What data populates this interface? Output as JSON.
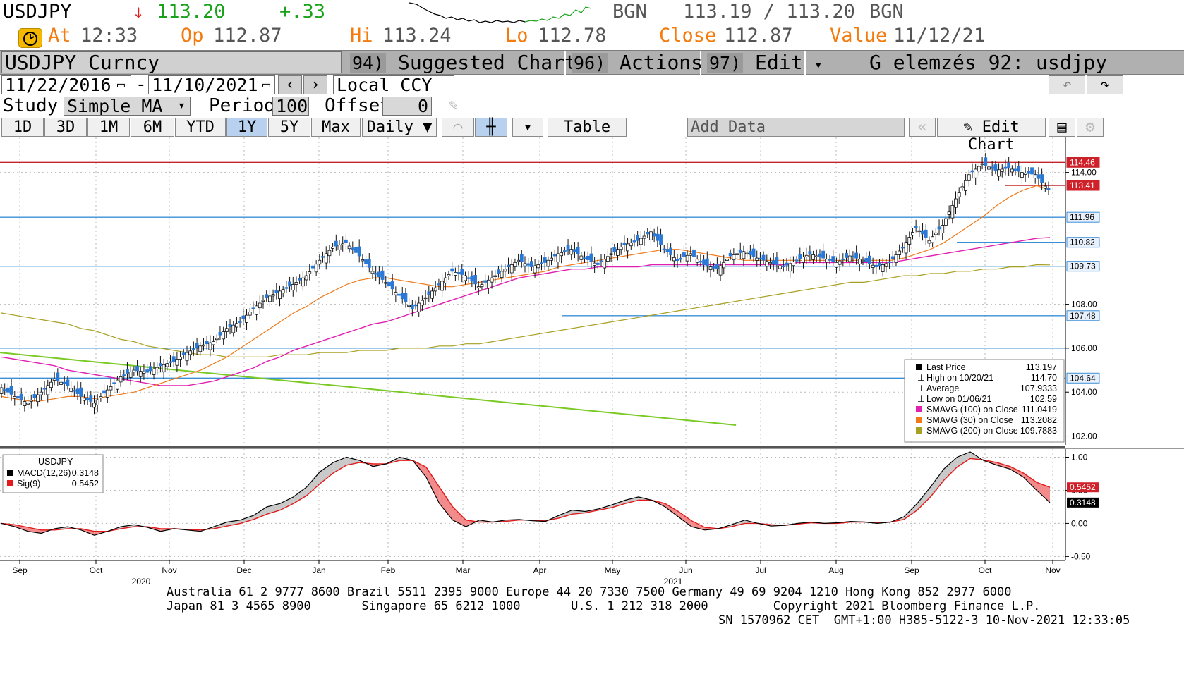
{
  "quote": {
    "ticker": "USDJPY",
    "arrow": "↓",
    "last": "113.20",
    "change": "+.33",
    "bid_src": "BGN",
    "bid_ask": "113.19 / 113.20",
    "ask_src": "BGN",
    "at_label": "At",
    "at_time": "12:33",
    "op_label": "Op",
    "op_value": "112.87",
    "hi_label": "Hi",
    "hi_value": "113.24",
    "lo_label": "Lo",
    "lo_value": "112.78",
    "close_label": "Close",
    "close_value": "112.87",
    "value_label": "Value",
    "value_date": "11/12/21"
  },
  "toolbar": {
    "security": "USDJPY Curncy",
    "suggested_num": "94)",
    "suggested": "Suggested Charts",
    "actions_num": "96)",
    "actions": "Actions",
    "edit_num": "97)",
    "edit": "Edit",
    "title": "G elemzés 92: usdjpy",
    "date_from": "11/22/2016",
    "date_sep": "-",
    "date_to": "11/10/2021",
    "currency": "Local CCY",
    "study_label": "Study",
    "study_value": "Simple MA",
    "period_label": "Period",
    "period_value": "100",
    "offset_label": "Offset",
    "offset_value": "0",
    "tabs": [
      "1D",
      "3D",
      "1M",
      "6M",
      "YTD",
      "1Y",
      "5Y",
      "Max"
    ],
    "selected_tab": "1Y",
    "frequency": "Daily ▼",
    "table": "Table",
    "add_data": "Add Data",
    "edit_chart": "Edit Chart"
  },
  "chart_data": {
    "type": "line",
    "price_panel": {
      "yticks": [
        "114.00",
        "108.00",
        "106.00",
        "104.00",
        "102.00"
      ],
      "ylim": [
        101.6,
        115.4
      ],
      "level_labels": [
        {
          "text": "114.46",
          "value": 114.46,
          "style": "red"
        },
        {
          "text": "113.41",
          "value": 113.41,
          "style": "red"
        },
        {
          "text": "111.96",
          "value": 111.96,
          "style": "blue"
        },
        {
          "text": "110.82",
          "value": 110.82,
          "style": "blue"
        },
        {
          "text": "109.73",
          "value": 109.73,
          "style": "blue"
        },
        {
          "text": "107.48",
          "value": 107.48,
          "style": "blue"
        },
        {
          "text": "104.64",
          "value": 104.64,
          "style": "blue"
        }
      ],
      "legend": [
        {
          "label": "Last Price",
          "value": "113.197",
          "color": "#000000"
        },
        {
          "label": "High on 10/20/21",
          "value": "114.70",
          "color": ""
        },
        {
          "label": "Average",
          "value": "107.9333",
          "color": ""
        },
        {
          "label": "Low on 01/06/21",
          "value": "102.59",
          "color": ""
        },
        {
          "label": "SMAVG (100)  on Close",
          "value": "111.0419",
          "color": "#e020b0"
        },
        {
          "label": "SMAVG (30)  on Close",
          "value": "113.2082",
          "color": "#f07a1a"
        },
        {
          "label": "SMAVG (200)  on Close",
          "value": "109.7883",
          "color": "#a8a020"
        }
      ],
      "price_series": [
        104.2,
        103.8,
        103.5,
        104.0,
        104.6,
        104.3,
        103.8,
        103.5,
        104.1,
        104.7,
        105.0,
        104.9,
        105.2,
        105.4,
        105.8,
        106.1,
        106.3,
        106.9,
        107.2,
        107.8,
        108.3,
        108.6,
        108.9,
        109.3,
        110.0,
        110.6,
        110.8,
        110.2,
        109.5,
        109.0,
        108.4,
        107.8,
        108.3,
        108.9,
        109.5,
        109.3,
        108.8,
        109.2,
        109.6,
        110.0,
        109.7,
        109.9,
        110.3,
        110.5,
        110.1,
        109.8,
        110.3,
        110.7,
        110.9,
        111.3,
        110.5,
        110.0,
        110.3,
        109.8,
        109.6,
        110.2,
        110.4,
        110.1,
        109.9,
        109.7,
        110.0,
        110.3,
        110.1,
        109.9,
        110.2,
        110.0,
        109.7,
        109.9,
        110.6,
        111.5,
        110.9,
        111.6,
        112.8,
        113.9,
        114.4,
        114.1,
        114.2,
        114.0,
        113.9,
        113.2
      ],
      "sma30_series": [
        103.8,
        103.7,
        103.6,
        103.6,
        103.7,
        103.8,
        103.8,
        103.7,
        103.8,
        103.9,
        104.0,
        104.2,
        104.4,
        104.6,
        104.8,
        105.0,
        105.3,
        105.6,
        106.0,
        106.4,
        106.8,
        107.2,
        107.6,
        107.9,
        108.3,
        108.6,
        108.9,
        109.1,
        109.2,
        109.2,
        109.1,
        109.0,
        108.9,
        108.8,
        108.8,
        108.9,
        109.0,
        109.1,
        109.2,
        109.3,
        109.4,
        109.5,
        109.7,
        109.8,
        109.9,
        110.0,
        110.1,
        110.2,
        110.3,
        110.4,
        110.5,
        110.5,
        110.4,
        110.3,
        110.2,
        110.1,
        110.0,
        110.0,
        110.0,
        110.0,
        110.0,
        110.0,
        110.0,
        110.0,
        110.0,
        110.0,
        110.0,
        110.0,
        110.1,
        110.3,
        110.5,
        110.8,
        111.2,
        111.6,
        112.0,
        112.5,
        112.9,
        113.2,
        113.4,
        113.2
      ],
      "sma100_series": [
        105.6,
        105.5,
        105.4,
        105.3,
        105.2,
        105.0,
        104.9,
        104.8,
        104.7,
        104.6,
        104.5,
        104.4,
        104.3,
        104.3,
        104.3,
        104.4,
        104.5,
        104.7,
        104.9,
        105.1,
        105.4,
        105.6,
        105.9,
        106.1,
        106.3,
        106.5,
        106.7,
        106.9,
        107.1,
        107.2,
        107.4,
        107.6,
        107.8,
        108.0,
        108.2,
        108.4,
        108.6,
        108.8,
        109.0,
        109.2,
        109.3,
        109.4,
        109.5,
        109.6,
        109.6,
        109.7,
        109.7,
        109.7,
        109.7,
        109.8,
        109.8,
        109.8,
        109.8,
        109.8,
        109.8,
        109.8,
        109.8,
        109.8,
        109.8,
        109.8,
        109.9,
        109.9,
        109.9,
        109.9,
        109.9,
        109.9,
        109.9,
        109.9,
        110.0,
        110.1,
        110.2,
        110.3,
        110.4,
        110.5,
        110.6,
        110.7,
        110.8,
        110.9,
        111.0,
        111.04
      ],
      "sma200_series": [
        107.6,
        107.5,
        107.4,
        107.3,
        107.2,
        107.1,
        106.9,
        106.8,
        106.6,
        106.4,
        106.3,
        106.1,
        106.0,
        105.9,
        105.8,
        105.7,
        105.7,
        105.6,
        105.6,
        105.6,
        105.6,
        105.7,
        105.7,
        105.7,
        105.8,
        105.8,
        105.8,
        105.9,
        105.9,
        105.9,
        106.0,
        106.0,
        106.0,
        106.1,
        106.1,
        106.2,
        106.2,
        106.3,
        106.4,
        106.5,
        106.6,
        106.7,
        106.8,
        106.9,
        107.0,
        107.1,
        107.2,
        107.3,
        107.4,
        107.5,
        107.6,
        107.7,
        107.8,
        107.9,
        108.0,
        108.1,
        108.2,
        108.3,
        108.4,
        108.5,
        108.6,
        108.7,
        108.8,
        108.9,
        109.0,
        109.0,
        109.1,
        109.2,
        109.3,
        109.3,
        109.4,
        109.4,
        109.5,
        109.5,
        109.6,
        109.6,
        109.7,
        109.7,
        109.8,
        109.79
      ],
      "trendline": [
        [
          0,
          105.8
        ],
        [
          0.69,
          102.5
        ]
      ]
    },
    "macd_panel": {
      "title": "USDJPY",
      "yticks": [
        "1.00",
        "0.50",
        "0.00",
        "-0.50"
      ],
      "ylim": [
        -0.56,
        1.08
      ],
      "legend": [
        {
          "label": "MACD(12,26)",
          "value": "0.3148",
          "color": "#000000"
        },
        {
          "label": "Sig(9)",
          "value": "0.5452",
          "color": "#e31b1b"
        }
      ],
      "last_labels": [
        {
          "text": "0.5452",
          "value": 0.5452,
          "style": "red"
        },
        {
          "text": "0.3148",
          "value": 0.3148,
          "style": "black"
        }
      ],
      "macd_series": [
        0.0,
        -0.05,
        -0.12,
        -0.15,
        -0.08,
        -0.05,
        -0.1,
        -0.18,
        -0.12,
        -0.05,
        -0.02,
        -0.06,
        -0.12,
        -0.08,
        -0.1,
        -0.12,
        -0.05,
        0.02,
        0.05,
        0.12,
        0.25,
        0.3,
        0.4,
        0.55,
        0.78,
        0.92,
        1.0,
        0.95,
        0.86,
        0.9,
        1.0,
        0.95,
        0.7,
        0.3,
        0.05,
        -0.05,
        0.05,
        0.02,
        0.05,
        0.06,
        0.04,
        0.03,
        0.12,
        0.2,
        0.18,
        0.22,
        0.28,
        0.35,
        0.4,
        0.35,
        0.25,
        0.1,
        -0.05,
        -0.1,
        -0.08,
        -0.02,
        0.05,
        0.0,
        -0.04,
        -0.03,
        0.0,
        0.02,
        0.0,
        0.01,
        0.03,
        0.02,
        0.0,
        0.02,
        0.1,
        0.3,
        0.55,
        0.82,
        1.0,
        1.08,
        0.95,
        0.88,
        0.82,
        0.7,
        0.5,
        0.3148
      ],
      "signal_series": [
        0.0,
        -0.02,
        -0.06,
        -0.1,
        -0.1,
        -0.08,
        -0.08,
        -0.12,
        -0.12,
        -0.08,
        -0.05,
        -0.05,
        -0.08,
        -0.08,
        -0.09,
        -0.1,
        -0.08,
        -0.04,
        0.0,
        0.06,
        0.14,
        0.2,
        0.3,
        0.42,
        0.6,
        0.76,
        0.88,
        0.92,
        0.9,
        0.9,
        0.95,
        0.95,
        0.85,
        0.55,
        0.25,
        0.05,
        0.02,
        0.02,
        0.03,
        0.05,
        0.05,
        0.04,
        0.08,
        0.14,
        0.16,
        0.2,
        0.24,
        0.3,
        0.35,
        0.35,
        0.3,
        0.18,
        0.04,
        -0.06,
        -0.08,
        -0.05,
        0.0,
        0.0,
        -0.02,
        -0.03,
        -0.01,
        0.01,
        0.0,
        0.0,
        0.02,
        0.02,
        0.01,
        0.02,
        0.06,
        0.2,
        0.4,
        0.65,
        0.85,
        0.98,
        0.96,
        0.92,
        0.86,
        0.76,
        0.62,
        0.5452
      ]
    },
    "x_months": [
      "Sep",
      "Oct",
      "Nov",
      "Dec",
      "Jan",
      "Feb",
      "Mar",
      "Apr",
      "May",
      "Jun",
      "Jul",
      "Aug",
      "Sep",
      "Oct",
      "Nov"
    ],
    "x_years": [
      "2020",
      "2021"
    ]
  },
  "footer": {
    "line1": "Australia 61 2 9777 8600 Brazil 5511 2395 9000 Europe 44 20 7330 7500 Germany 49 69 9204 1210 Hong Kong 852 2977 6000",
    "line2": "Japan 81 3 4565 8900       Singapore 65 6212 1000       U.S. 1 212 318 2000         Copyright 2021 Bloomberg Finance L.P.",
    "line3": "SN 1570962 CET  GMT+1:00 H385-5122-3 10-Nov-2021 12:33:05"
  },
  "colors": {
    "accent_green": "#1aa31a",
    "accent_red": "#e31b1b",
    "accent_orange": "#f47c0f",
    "candle_blue": "#2b79d6",
    "resistance_red": "#c4242b",
    "support_blue": "#3b8fd8"
  }
}
